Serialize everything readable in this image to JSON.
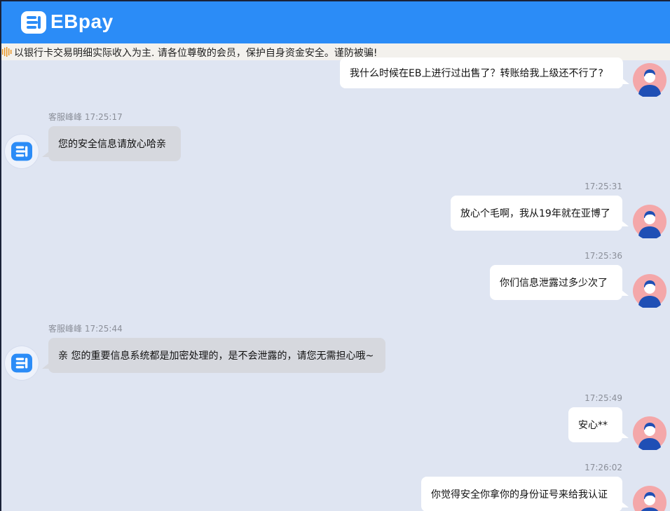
{
  "header": {
    "logo_text": "EBpay",
    "brand_color": "#2b8cf7",
    "logo_icon": "eb-logo-icon"
  },
  "notice": {
    "icon": "sound-wave-icon",
    "text": "以银行卡交易明细实际收入为主. 请各位尊敬的会员，保护自身资金安全。谨防被骗!"
  },
  "agent": {
    "name": "客服峰峰"
  },
  "messages": [
    {
      "side": "out",
      "time": "",
      "text": "我什么时候在EB上进行过出售了？转账给我上级还不行了?"
    },
    {
      "side": "in",
      "time": "17:25:17",
      "text": "您的安全信息请放心哈亲"
    },
    {
      "side": "out",
      "time": "17:25:31",
      "text": "放心个毛啊，我从19年就在亚博了"
    },
    {
      "side": "out",
      "time": "17:25:36",
      "text": "你们信息泄露过多少次了"
    },
    {
      "side": "in",
      "time": "17:25:44",
      "text": "亲 您的重要信息系统都是加密处理的，是不会泄露的，请您无需担心哦~"
    },
    {
      "side": "out",
      "time": "17:25:49",
      "text": "安心**"
    },
    {
      "side": "out",
      "time": "17:26:02",
      "text": "你觉得安全你拿你的身份证号来给我认证"
    }
  ]
}
